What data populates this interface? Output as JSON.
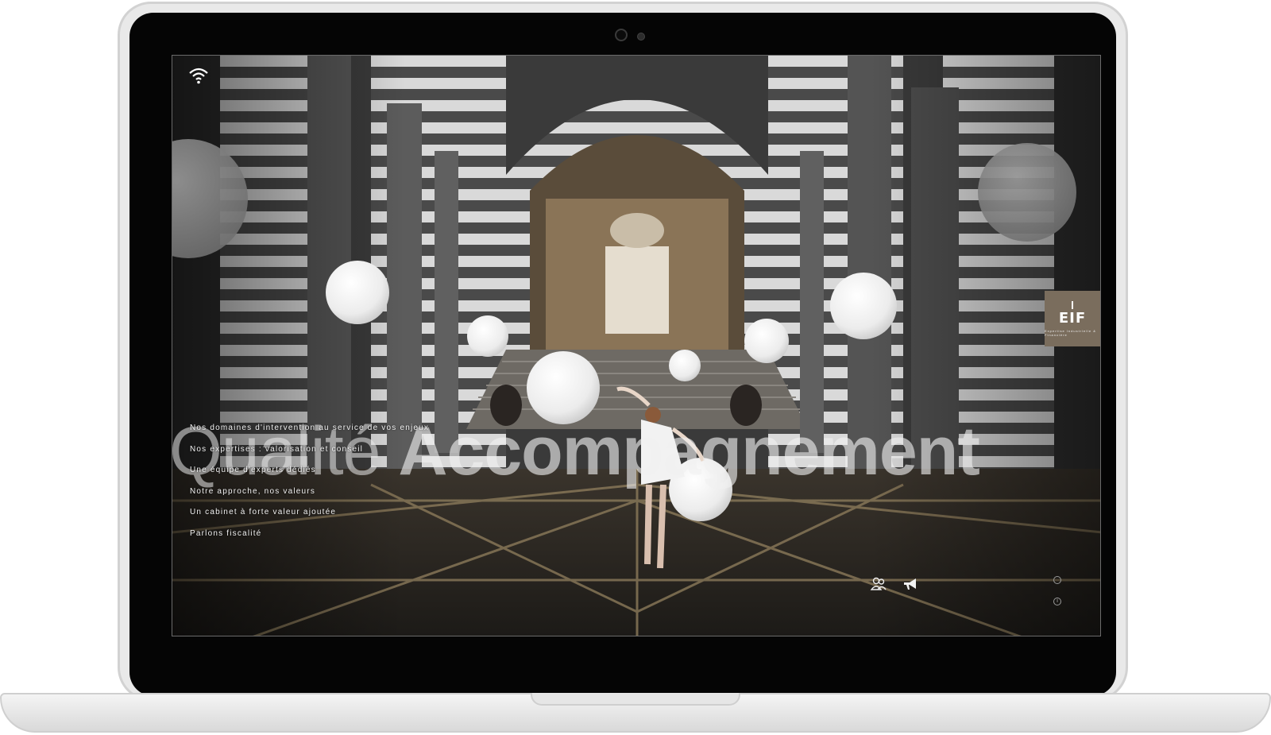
{
  "hero": {
    "title_word_1": "Qualité",
    "title_word_2": "Accompagnement"
  },
  "logo": {
    "text": "EIF",
    "subtitle": "Expertise Industrielle & Financière"
  },
  "nav": {
    "items": [
      "Nos domaines d'intervention au service de vos enjeux",
      "Nos expertises : valorisation et conseil",
      "Une équipe d'experts dédiés",
      "Notre approche, nos valeurs",
      "Un cabinet à forte valeur ajoutée",
      "Parlons fiscalité"
    ]
  },
  "icons": {
    "wifi": "wifi-icon",
    "team": "team-icon",
    "megaphone": "megaphone-icon",
    "language": "language-icon",
    "info": "info-icon"
  },
  "colors": {
    "logo_bg": "#7a6d5d",
    "nav_text": "#f1f1f1",
    "screen_bg": "#2b2b2b"
  }
}
